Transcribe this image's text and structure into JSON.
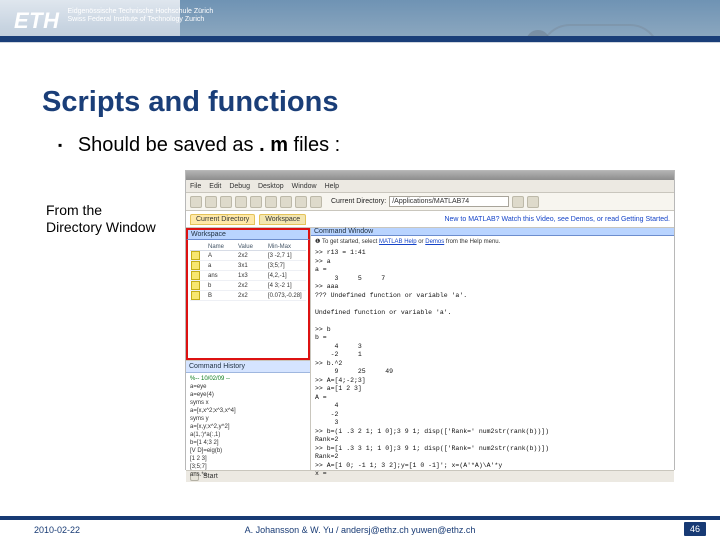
{
  "logo": {
    "mark": "ETH",
    "line1": "Eidgenössische Technische Hochschule Zürich",
    "line2": "Swiss Federal Institute of Technology Zurich"
  },
  "title": "Scripts and functions",
  "bullet": {
    "pre": "Should be saved as",
    "bold": ". m",
    "post": " files :"
  },
  "caption": {
    "l1": "From the",
    "l2": "Directory Window"
  },
  "matlab": {
    "menu": [
      "File",
      "Edit",
      "Debug",
      "Desktop",
      "Window",
      "Help"
    ],
    "curdir_label": "Current Directory:",
    "curdir_value": "/Applications/MATLAB74",
    "shortcuts": {
      "tab1": "Current Directory",
      "tab2": "Workspace",
      "np": "New to MATLAB? Watch this Video, see Demos, or read Getting Started."
    },
    "intro": {
      "pre": "To get started, select ",
      "l1": "MATLAB Help",
      "mid": " or ",
      "l2": "Demos",
      "post": " from the Help menu."
    },
    "workspace": {
      "title": "Workspace",
      "cols": [
        "",
        "Name",
        "Value",
        "Min-Max"
      ],
      "rows": [
        [
          "",
          "A",
          "2x2",
          "[3 -2,7 1]"
        ],
        [
          "",
          "a",
          "3x1",
          "[3;5;7]"
        ],
        [
          "",
          "ans",
          "1x3",
          "[4,2,-1]"
        ],
        [
          "",
          "b",
          "2x2",
          "[4 3;-2 1]"
        ],
        [
          "",
          "B",
          "2x2",
          "[0.073,-0.28]"
        ]
      ]
    },
    "cmdhist": {
      "title": "Command History",
      "lines": [
        "%-- 10/02/09 --",
        "a=eye",
        "a=eye(4)",
        "syms x",
        "a=[x,x^2;x^3,x^4]",
        "syms y",
        "a=[x,y;x^2,y^2]",
        "a(1,:)*a(:,1)",
        "b=[1 4;3 2]",
        "[V D]=eig(b)",
        "[1 2 3]",
        "[3;5;7]",
        "ans.*a"
      ]
    },
    "cmdwin": {
      "title": "Command Window",
      "body": ">> r13 = 1:41\n>> a\na =\n     3     5     7\n>> aaa\n??? Undefined function or variable 'a'.\n\nUndefined function or variable 'a'.\n\n>> b\nb =\n     4     3\n    -2     1\n>> b.^2\n     9     25     49\n>> A=[4;-2;3]\n>> a=[1 2 3]\nA =\n     4\n    -2\n     3\n>> b=(i .3 2 1; 1 0];3 9 1; disp(['Rank=' num2str(rank(b))])\nRank=2\n>> b=[i .3 3 1; 1 0];3 9 1; disp(['Rank=' num2str(rank(b))])\nRank=2\n>> A=[1 0; -1 1; 3 2];y=[1 0 -1]'; x=(A'*A)\\A'*y\nx =\n"
    },
    "status": "Start"
  },
  "footer": {
    "date": "2010-02-22",
    "authors": "A. Johansson & W. Yu / andersj@ethz.ch  yuwen@ethz.ch",
    "page": "46"
  }
}
